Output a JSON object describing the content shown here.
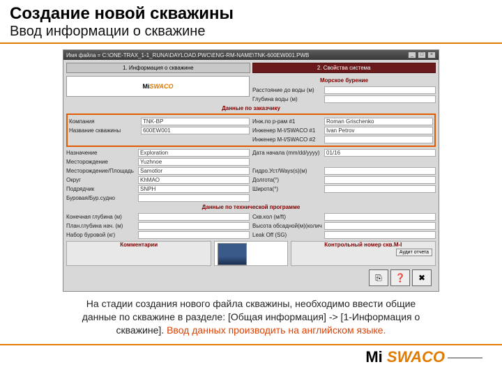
{
  "slide": {
    "title": "Создание новой скважины",
    "subtitle": "Ввод информации о скважине"
  },
  "window": {
    "title": "Имя файла = C:\\ONE-TRAX_1-1_RUNA\\DAYLOAD.PWC\\ENG-RM-NAME\\TNK-600EW001.PWB",
    "buttons": {
      "min": "_",
      "max": "□",
      "close": "×"
    }
  },
  "tabs": {
    "tab1": "1. Информация о скважине",
    "tab2": "2. Свойства система"
  },
  "logo": {
    "mi": "Mi ",
    "swaco": "SWACO"
  },
  "sections": {
    "offshore": "Морское бурение",
    "customer": "Данные по заказчику",
    "tech": "Данные по технической программе",
    "comments": "Комментарии",
    "control": "Контрольный номер скв.M-I"
  },
  "fieldsL": {
    "company": {
      "label": "Компания",
      "value": "TNK-BP"
    },
    "wellname": {
      "label": "Название скважины",
      "value": "600EW001"
    },
    "purpose": {
      "label": "Назначение",
      "value": "Exploration"
    },
    "field": {
      "label": "Месторождение",
      "value": "Yuzhnoe"
    },
    "fieldpad": {
      "label": "Месторождение/Площадь",
      "value": "Samotlor"
    },
    "district": {
      "label": "Округ",
      "value": "KhMAO"
    },
    "contractor": {
      "label": "Подрядчик",
      "value": "SNPH"
    },
    "rigtype": {
      "label": "Буровая/Бур.судно",
      "value": ""
    },
    "enddepth": {
      "label": "Конечная глубина (м)",
      "value": ""
    },
    "plandepth": {
      "label": "План.глубина нач. (м)",
      "value": ""
    },
    "drillmethod": {
      "label": "Набор буровой (кг)",
      "value": ""
    }
  },
  "fieldsR": {
    "waterdist": {
      "label": "Расстояние до воды (м)",
      "value": ""
    },
    "waterdepth": {
      "label": "Глубина воды (м)",
      "value": ""
    },
    "eng1": {
      "label": "Инж.по р-рам #1",
      "value": "Roman Grischenko"
    },
    "eng2": {
      "label": "Инженер M-I/SWACO #1",
      "value": "Ivan Petrov"
    },
    "eng3": {
      "label": "Инженер M-I/SWACO #2",
      "value": ""
    },
    "startdate": {
      "label": "Дата начала (mm/dd/yyyy)",
      "value": "01/16"
    },
    "wellhead": {
      "label": "Гидро.Уст/Ways(s)(м)",
      "value": ""
    },
    "longitude": {
      "label": "Долгота(°)",
      "value": ""
    },
    "latitude": {
      "label": "Широта(°)",
      "value": ""
    },
    "wellcount": {
      "label": "Скв.кол (м/ft)",
      "value": ""
    },
    "casing": {
      "label": "Высота обсадной(м)(колич.)",
      "value": ""
    },
    "leak": {
      "label": "Leak Off (SG)",
      "value": ""
    }
  },
  "audit": {
    "button": "Аудит отчета"
  },
  "caption": {
    "line1": "На стадии создания нового файла скважины, необходимо ввести общие",
    "line2": "данные по скважине в разделе: [Общая информация] -> [1-Информация о",
    "line3a": "скважине]. ",
    "line3b": "Ввод данных производить на английском языке."
  },
  "toolbtns": {
    "a": "⎘",
    "b": "❓",
    "c": "✖"
  }
}
